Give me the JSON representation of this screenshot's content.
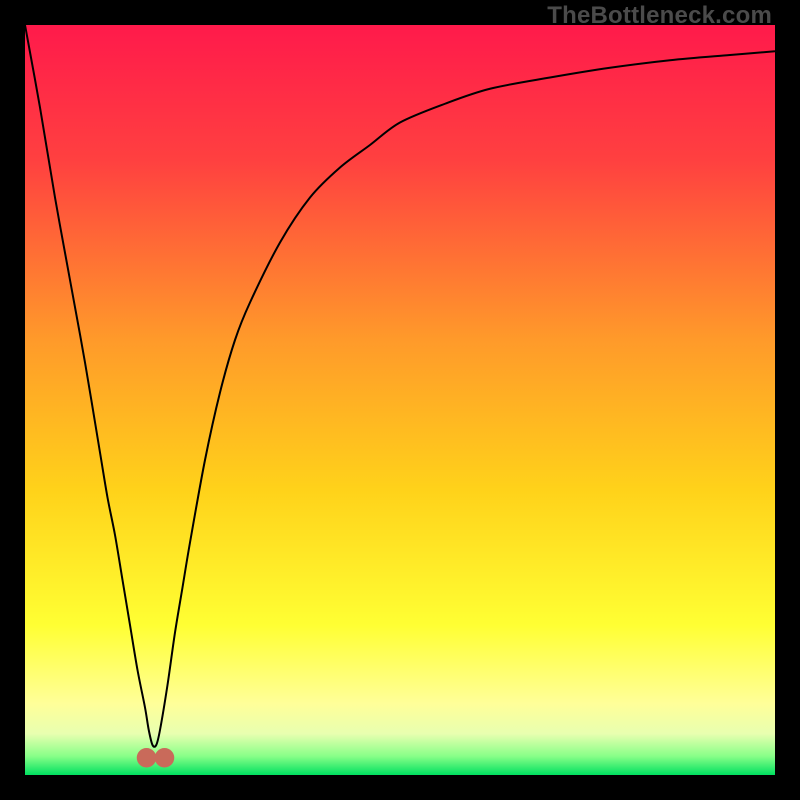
{
  "watermark": "TheBottleneck.com",
  "chart_data": {
    "type": "line",
    "title": "",
    "xlabel": "",
    "ylabel": "",
    "xlim": [
      0,
      100
    ],
    "ylim": [
      0,
      100
    ],
    "grid": false,
    "legend": false,
    "background_gradient": {
      "stops": [
        {
          "offset": 0.0,
          "color": "#ff1a4b"
        },
        {
          "offset": 0.18,
          "color": "#ff4040"
        },
        {
          "offset": 0.42,
          "color": "#ff9a2a"
        },
        {
          "offset": 0.62,
          "color": "#ffd21a"
        },
        {
          "offset": 0.8,
          "color": "#ffff33"
        },
        {
          "offset": 0.905,
          "color": "#ffff99"
        },
        {
          "offset": 0.945,
          "color": "#e8ffb0"
        },
        {
          "offset": 0.975,
          "color": "#88ff88"
        },
        {
          "offset": 1.0,
          "color": "#00e060"
        }
      ]
    },
    "series": [
      {
        "name": "curve",
        "color": "#000000",
        "x": [
          0,
          2,
          4,
          6,
          8,
          10,
          11,
          12,
          13,
          14,
          15,
          16,
          16.5,
          17,
          17.5,
          18,
          19,
          20,
          21,
          22,
          24,
          26,
          28,
          30,
          34,
          38,
          42,
          46,
          50,
          56,
          62,
          70,
          78,
          86,
          94,
          100
        ],
        "y": [
          100,
          89,
          77,
          66,
          55,
          43,
          37,
          32,
          26,
          20,
          14,
          9,
          6,
          4,
          4,
          6,
          12,
          19,
          25,
          31,
          42,
          51,
          58,
          63,
          71,
          77,
          81,
          84,
          87,
          89.5,
          91.5,
          93,
          94.3,
          95.3,
          96,
          96.5
        ]
      }
    ],
    "markers": [
      {
        "name": "min-left",
        "x": 16.2,
        "y": 2.3,
        "r": 1.3,
        "color": "#c96a5a"
      },
      {
        "name": "min-right",
        "x": 18.6,
        "y": 2.3,
        "r": 1.3,
        "color": "#c96a5a"
      }
    ]
  }
}
